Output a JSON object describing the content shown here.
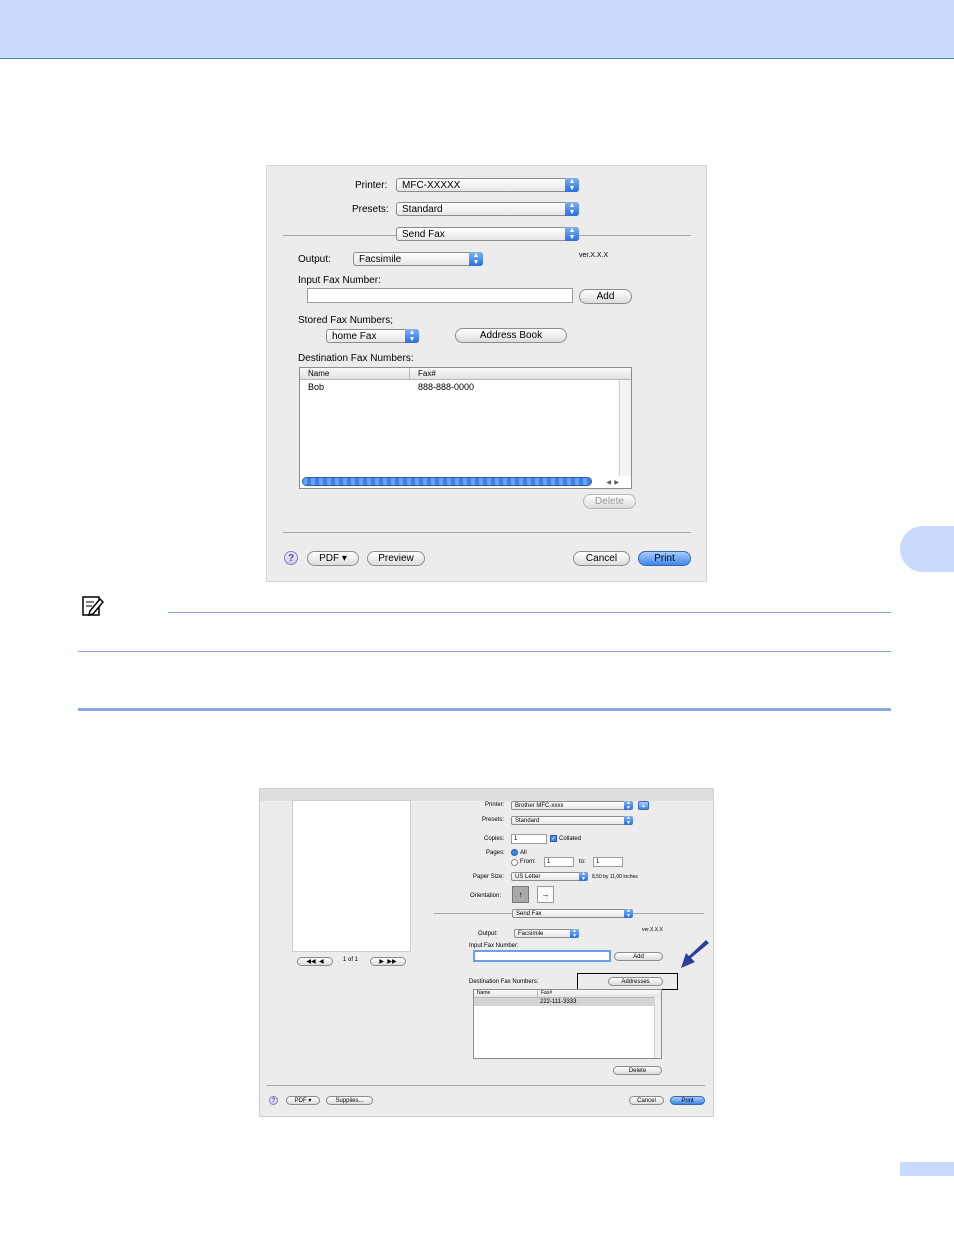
{
  "dialog1": {
    "printer_label": "Printer:",
    "printer_value": "MFC-XXXXX",
    "presets_label": "Presets:",
    "presets_value": "Standard",
    "panel_value": "Send Fax",
    "output_label": "Output:",
    "output_value": "Facsimile",
    "version": "ver.X.X.X",
    "input_fax_label": "Input Fax Number:",
    "add_button": "Add",
    "stored_label": "Stored Fax Numbers;",
    "stored_value": "home Fax",
    "address_book_button": "Address Book",
    "destination_label": "Destination Fax Numbers:",
    "table": {
      "headers": [
        "Name",
        "Fax#"
      ],
      "rows": [
        {
          "name": "Bob",
          "fax": "888-888-0000"
        }
      ]
    },
    "delete_button": "Delete",
    "help_glyph": "?",
    "pdf_button": "PDF ▾",
    "preview_button": "Preview",
    "cancel_button": "Cancel",
    "print_button": "Print"
  },
  "dialog2": {
    "printer_label": "Printer:",
    "printer_value": "Brother MFC-xxxx",
    "presets_label": "Presets:",
    "presets_value": "Standard",
    "copies_label": "Copies:",
    "copies_value": "1",
    "collated_label": "Collated",
    "pages_label": "Pages:",
    "pages_all": "All",
    "pages_from": "From:",
    "from_value": "1",
    "to_label": "to:",
    "to_value": "1",
    "paper_label": "Paper Size:",
    "paper_value": "US Letter",
    "paper_dims": "8,50 by 11,00 inches",
    "orientation_label": "Orientation:",
    "panel_value": "Send Fax",
    "output_label": "Output:",
    "output_value": "Facsimile",
    "version": "ver.X.X.X",
    "input_fax_label": "Input Fax Number:",
    "add_button": "Add",
    "destination_label": "Destination Fax Numbers:",
    "addresses_button": "Addresses",
    "table": {
      "headers": [
        "Name",
        "Fax#"
      ],
      "rows": [
        {
          "name": "",
          "fax": "222-111-3333"
        }
      ]
    },
    "delete_button": "Delete",
    "page_indicator": "1 of 1",
    "help_glyph": "?",
    "pdf_button": "PDF ▾",
    "supplies_button": "Supplies...",
    "cancel_button": "Cancel",
    "print_button": "Print"
  },
  "colors": {
    "accent": "#c9dafc",
    "rule": "#8aa6e6",
    "arrow": "#2f3c9a"
  }
}
